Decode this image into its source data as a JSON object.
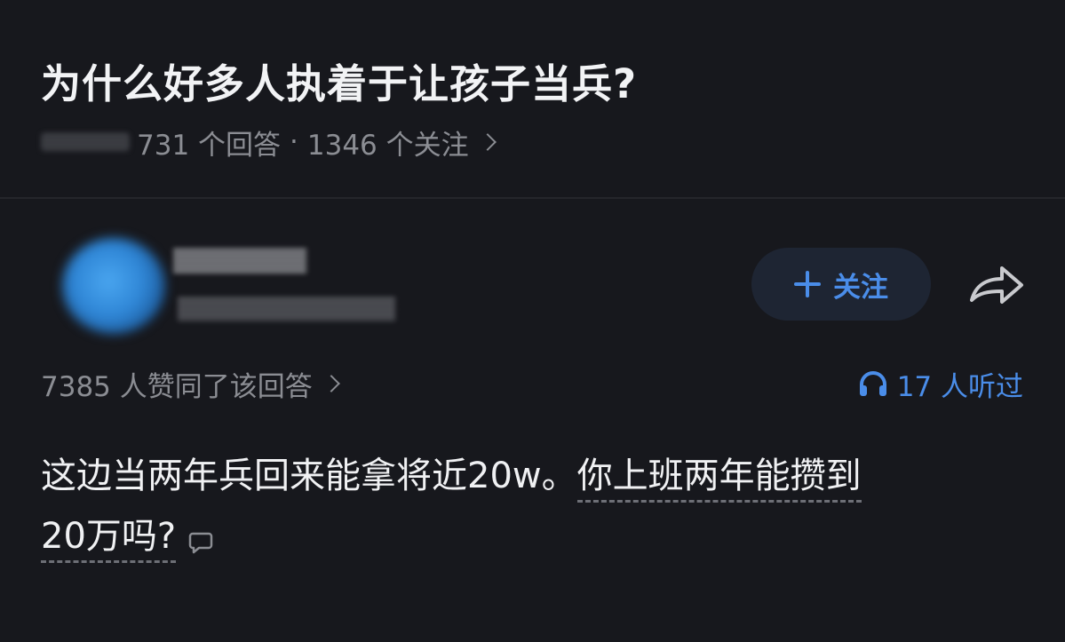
{
  "question": {
    "title": "为什么好多人执着于让孩子当兵?",
    "answer_count": "731 个回答",
    "separator": "·",
    "follower_count": "1346 个关注"
  },
  "author": {
    "follow_label": "关注"
  },
  "answer": {
    "vote_text": "7385 人赞同了该回答",
    "listen_text": "17 人听过",
    "body_part1": "这边当两年兵回来能拿将近20w。",
    "body_part2": "你上班两年能攒到",
    "body_line2": "20万吗?"
  },
  "icons": {
    "follow": "plus-icon",
    "share": "share-arrow-icon",
    "listen": "headphone-icon",
    "comment": "comment-bubble-icon",
    "chevron": "chevron-right-icon"
  },
  "colors": {
    "background": "#17181d",
    "accent": "#4a8de9",
    "muted_text": "#8b8d93"
  }
}
